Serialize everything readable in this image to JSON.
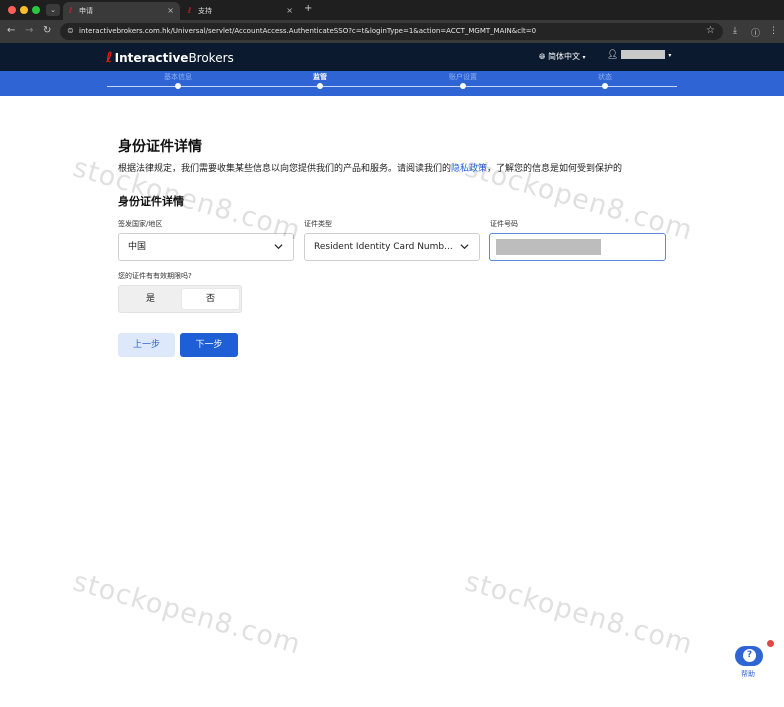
{
  "browser": {
    "tabs": [
      {
        "title": "申请",
        "close": "×"
      },
      {
        "title": "支持",
        "close": "×"
      }
    ],
    "new_tab": "+",
    "url": "interactivebrokers.com.hk/Universal/servlet/AccountAccess.AuthenticateSSO?c=t&loginType=1&action=ACCT_MGMT_MAIN&clt=0"
  },
  "header": {
    "logo_bold": "Interactive",
    "logo_thin": "Brokers",
    "language": "简体中文"
  },
  "stepper": {
    "steps": [
      "基本信息",
      "监管",
      "账户设置",
      "状态"
    ],
    "active_index": 1
  },
  "page": {
    "title": "身份证件详情",
    "intro_before": "根据法律规定，我们需要收集某些信息以向您提供我们的产品和服务。请阅读我们的",
    "intro_link": "隐私政策",
    "intro_after": "，了解您的信息是如何受到保护的",
    "section_title": "身份证件详情"
  },
  "form": {
    "country_label": "签发国家/地区",
    "country_value": "中国",
    "doc_type_label": "证件类型",
    "doc_type_value": "Resident Identity Card Numb...",
    "doc_number_label": "证件号码",
    "expiry_question": "您的证件有有效期限吗?",
    "expiry_yes": "是",
    "expiry_no": "否",
    "expiry_selected": "否"
  },
  "buttons": {
    "prev": "上一步",
    "next": "下一步"
  },
  "help": {
    "label": "帮助",
    "icon_text": "?"
  },
  "watermark": "stockopen8.com",
  "colors": {
    "brand_blue": "#2f64d4",
    "header_dark": "#0b1a2e",
    "logo_red": "#d91e18"
  }
}
